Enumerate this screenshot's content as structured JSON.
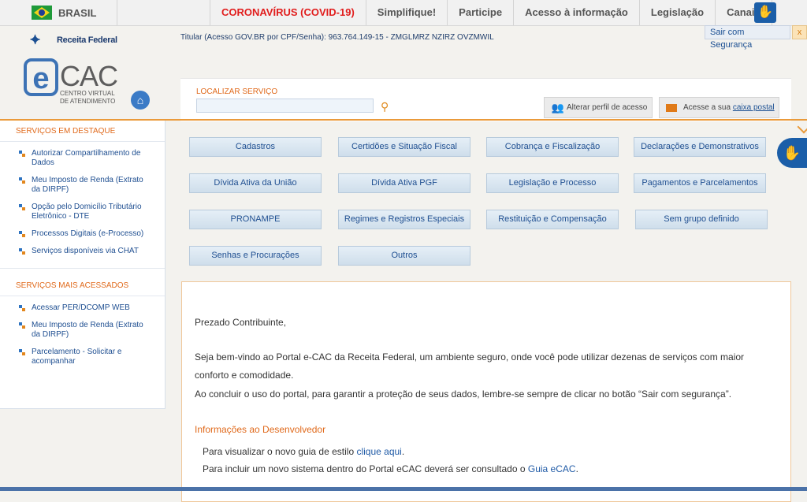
{
  "gov": {
    "country": "BRASIL",
    "links": [
      "CORONAVÍRUS (COVID-19)",
      "Simplifique!",
      "Participe",
      "Acesso à informação",
      "Legislação",
      "Canais"
    ]
  },
  "header": {
    "rf_logo_text": "Receita Federal",
    "titular": "Titular (Acesso GOV.BR por CPF/Senha): 963.764.149-15 - ZMGLMRZ NZIRZ OVZMWIL",
    "sair_label": "Sair com Segurança",
    "sair_close": "x",
    "ecac_cac": "CAC",
    "ecac_sub": "CENTRO VIRTUAL DE ATENDIMENTO"
  },
  "search": {
    "label": "LOCALIZAR SERVIÇO",
    "placeholder": "",
    "perfil_label": "Alterar perfil de acesso",
    "caixa_prefix": "Acesse a sua ",
    "caixa_link": "caixa postal"
  },
  "sidebar": {
    "destaque_title": "SERVIÇOS EM DESTAQUE",
    "destaque": [
      "Autorizar Compartilhamento de Dados",
      "Meu Imposto de Renda (Extrato da DIRPF)",
      "Opção pelo Domicílio Tributário Eletrônico - DTE",
      "Processos Digitais (e-Processo)",
      "Serviços disponíveis via CHAT"
    ],
    "acessados_title": "SERVIÇOS MAIS ACESSADOS",
    "acessados": [
      "Acessar PER/DCOMP WEB",
      "Meu Imposto de Renda (Extrato da DIRPF)",
      "Parcelamento - Solicitar e acompanhar"
    ]
  },
  "services": [
    "Cadastros",
    "Certidões e Situação Fiscal",
    "Cobrança e Fiscalização",
    "Declarações e Demonstrativos",
    "Dívida Ativa da União",
    "Dívida Ativa PGF",
    "Legislação e Processo",
    "Pagamentos e Parcelamentos",
    "PRONAMPE",
    "Regimes e Registros Especiais",
    "Restituição e Compensação",
    "Sem grupo definido",
    "Senhas e Procurações",
    "Outros"
  ],
  "content": {
    "greeting": "Prezado Contribuinte,",
    "p1": "Seja bem-vindo ao Portal e-CAC da Receita Federal, um ambiente seguro, onde você pode utilizar dezenas de serviços com maior conforto e comodidade.",
    "p2": "Ao concluir o uso do portal, para garantir a proteção de seus dados, lembre-se sempre de clicar no botão “Sair com segurança”.",
    "dev_title": "Informações ao Desenvolvedor",
    "l1_text": "Para visualizar o novo guia de estilo ",
    "l1_link": "clique aqui",
    "l1_end": ".",
    "l2_text": "Para incluir um novo sistema dentro do Portal eCAC deverá ser consultado o ",
    "l2_link": "Guia eCAC",
    "l2_end": "."
  }
}
